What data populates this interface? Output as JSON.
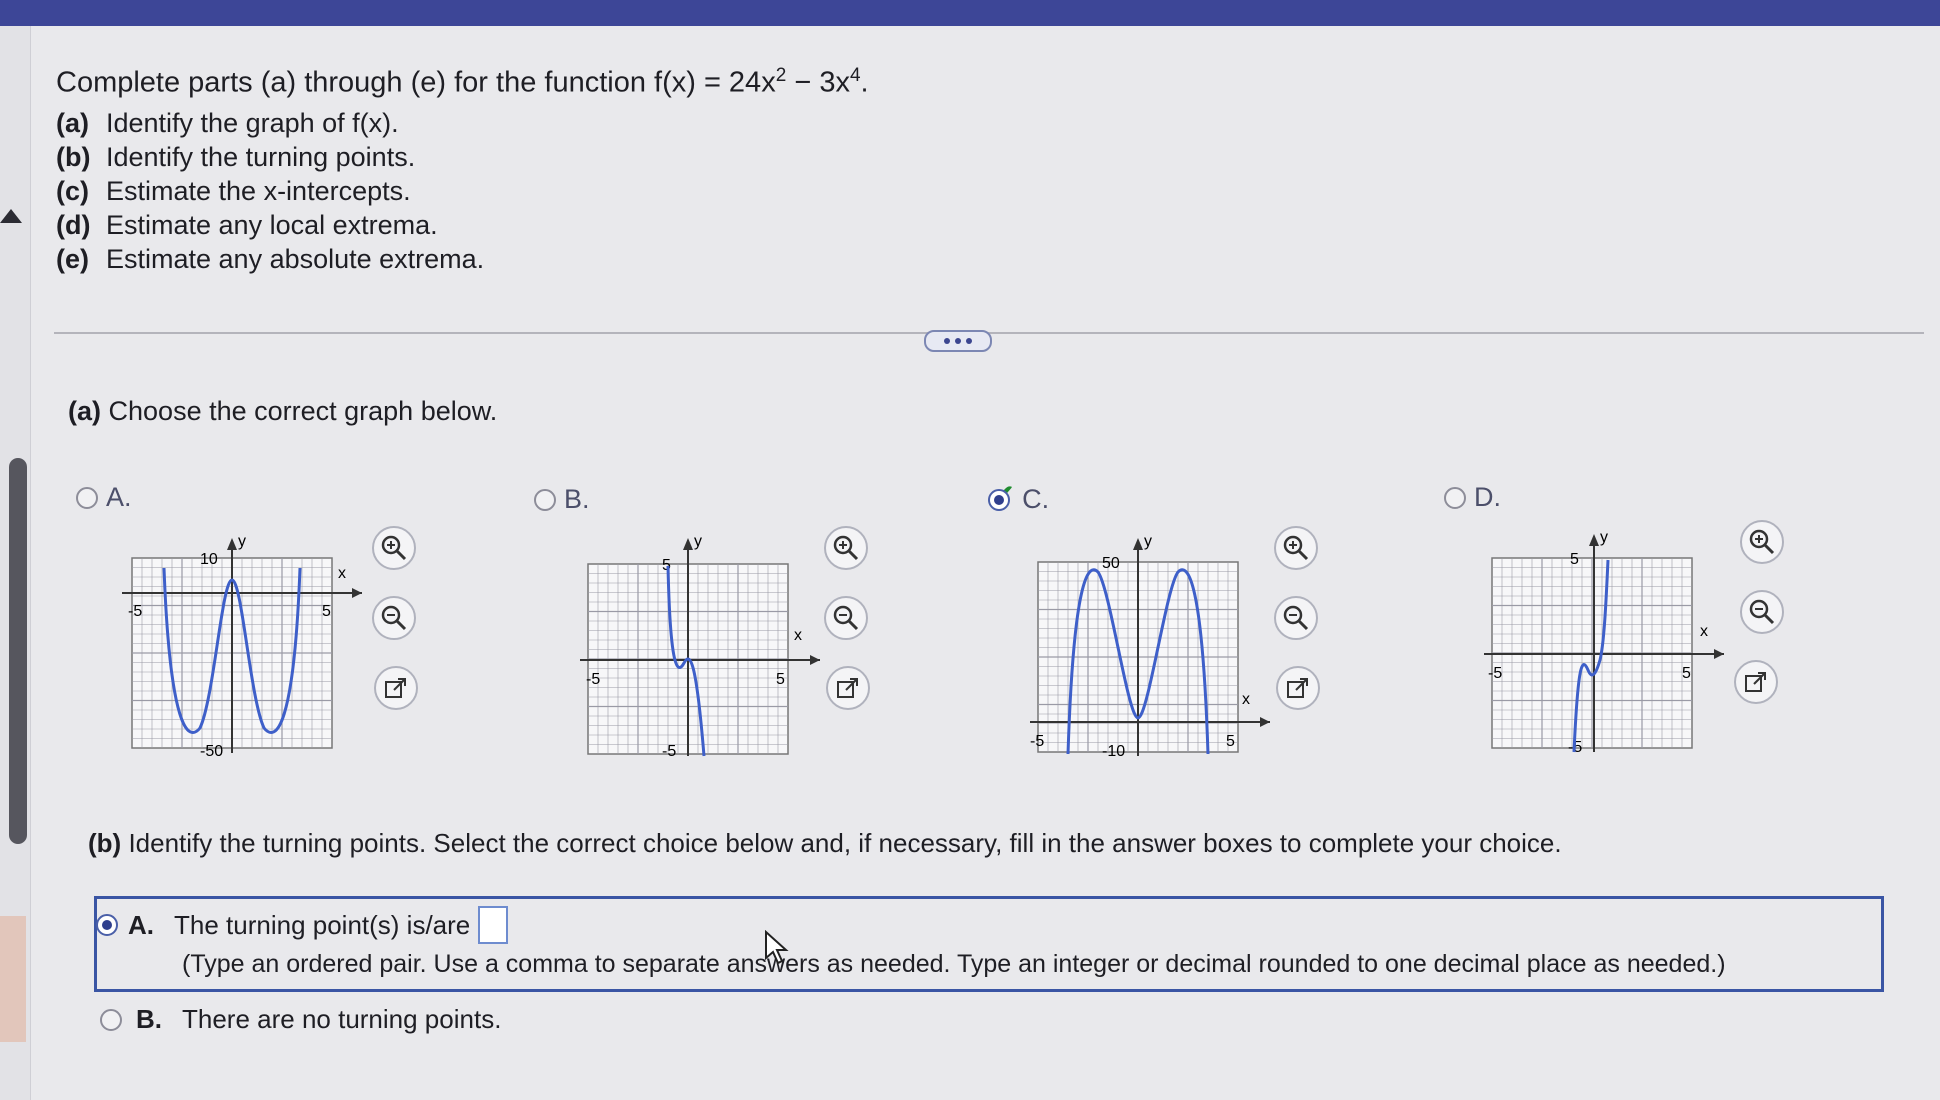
{
  "question": {
    "prefix": "Complete parts (a) through (e) for the function f(x) = 24x",
    "exp1": "2",
    "mid": " − 3x",
    "exp2": "4",
    "suffix": "."
  },
  "parts": [
    {
      "label": "(a)",
      "text": "Identify the graph of f(x)."
    },
    {
      "label": "(b)",
      "text": "Identify the turning points."
    },
    {
      "label": "(c)",
      "text": "Estimate the x-intercepts."
    },
    {
      "label": "(d)",
      "text": "Estimate any local extrema."
    },
    {
      "label": "(e)",
      "text": "Estimate any absolute extrema."
    }
  ],
  "part_a": {
    "label": "(a)",
    "text": "Choose the correct graph below."
  },
  "options": [
    {
      "letter": "A.",
      "selected": false,
      "correct_mark": false
    },
    {
      "letter": "B.",
      "selected": false,
      "correct_mark": false
    },
    {
      "letter": "C.",
      "selected": true,
      "correct_mark": true
    },
    {
      "letter": "D.",
      "selected": false,
      "correct_mark": false
    }
  ],
  "graphs": [
    {
      "ylabel": "y",
      "xlabel": "x",
      "ytop": "10",
      "ybottom": "-50",
      "xleft": "-5",
      "xright": "5"
    },
    {
      "ylabel": "y",
      "xlabel": "x",
      "ytop": "5",
      "ybottom": "-5",
      "xleft": "-5",
      "xright": "5"
    },
    {
      "ylabel": "y",
      "xlabel": "x",
      "ytop": "50",
      "ybottom": "-10",
      "xleft": "-5",
      "xright": "5"
    },
    {
      "ylabel": "y",
      "xlabel": "x",
      "ytop": "5",
      "ybottom": "-5",
      "xleft": "-5",
      "xright": "5"
    }
  ],
  "icons": {
    "zoom_in": "zoom-in-icon",
    "zoom_out": "zoom-out-icon",
    "external": "external-link-icon",
    "collapse": "more-dots-icon"
  },
  "part_b": {
    "label": "(b)",
    "text": "Identify the turning points. Select the correct choice below and, if necessary, fill in the answer boxes to complete your choice."
  },
  "answer_a": {
    "letter": "A.",
    "text": "The turning point(s) is/are",
    "hint": "(Type an ordered pair. Use a comma to separate answers as needed. Type an integer or decimal rounded to one decimal place as needed.)",
    "value": ""
  },
  "answer_b": {
    "letter": "B.",
    "text": "There are no turning points."
  },
  "colors": {
    "accent": "#3a55a4",
    "curve": "#3e5fc9",
    "check": "#1f8c2f"
  }
}
